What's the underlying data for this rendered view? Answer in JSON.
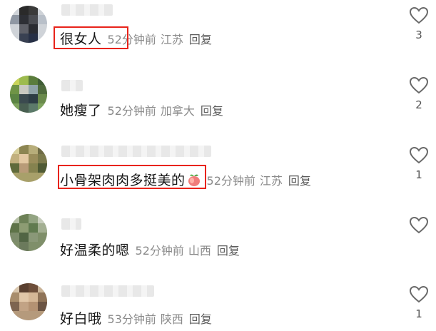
{
  "comments": [
    {
      "text": "很女人",
      "time": "52分钟前",
      "location": "江苏",
      "reply_label": "回复",
      "likes": "3",
      "highlighted": true
    },
    {
      "text": "她瘦了",
      "time": "52分钟前",
      "location": "加拿大",
      "reply_label": "回复",
      "likes": "2",
      "highlighted": false
    },
    {
      "text": "小骨架肉肉多挺美的",
      "emoji": "peach-emoji",
      "time": "52分钟前",
      "location": "江苏",
      "reply_label": "回复",
      "likes": "1",
      "highlighted": true
    },
    {
      "text": "好温柔的嗯",
      "time": "52分钟前",
      "location": "山西",
      "reply_label": "回复",
      "likes": "",
      "highlighted": false
    },
    {
      "text": "好白哦",
      "time": "53分钟前",
      "location": "陕西",
      "reply_label": "回复",
      "likes": "1",
      "highlighted": false
    }
  ],
  "colors": {
    "highlight_box": "#e8231a",
    "text": "#161616",
    "meta": "#8a8a8a"
  }
}
